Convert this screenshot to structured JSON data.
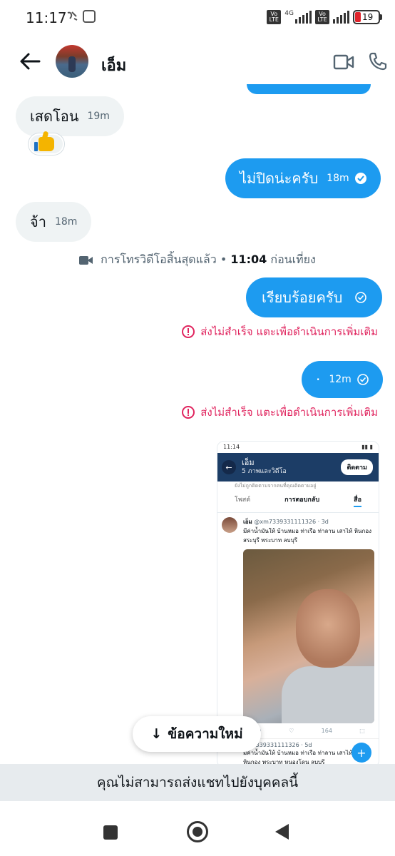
{
  "status_bar": {
    "time": "11:17",
    "net_type": "4G",
    "volte_label": "Vo LTE",
    "battery": "19"
  },
  "header": {
    "contact_name": "เอ็ม"
  },
  "messages": [
    {
      "direction": "in",
      "text": "เสดโอน",
      "time": "19m",
      "reaction": "thumbs-up"
    },
    {
      "direction": "out",
      "text": "ไม่ปิดน่ะครับ",
      "time": "18m",
      "status": "read"
    },
    {
      "direction": "in",
      "text": "จ้า",
      "time": "18m"
    },
    {
      "direction": "out",
      "text": "เรียบร้อยครับ",
      "time": "",
      "status": "failed"
    },
    {
      "direction": "out",
      "text": "·",
      "time": "12m",
      "status": "failed"
    }
  ],
  "call_notice": {
    "text": "การโทรวิดีโอสิ้นสุดแล้ว",
    "separator": "•",
    "time": "11:04",
    "suffix": "ก่อนเที่ยง"
  },
  "error_text": "ส่งไม่สำเร็จ แตะเพื่อดำเนินการเพิ่มเติม",
  "image_message": {
    "status_time": "11:14",
    "profile_name": "เอ็ม",
    "profile_sub": "5 ภาพและวิดีโอ",
    "follow_label": "ติดตาม",
    "note": "ยังไม่ถูกติดตามจากคนที่คุณติดตามอยู่",
    "tabs": [
      "โพสต์",
      "การตอบกลับ",
      "สื่อ"
    ],
    "post1_name": "เอ็ม",
    "post1_handle": "@xm7339331111326 · 3d",
    "post1_text": "มีค่าน้ำมันให้ บ้านหมอ ท่าเรือ ท่าลาน เสาไห้ หินกอง สระบุรี พระบาท ลบบุรี",
    "views": "164",
    "post2_handle": "xm7339331111326 · 5d",
    "post2_text": "มีค่าน้ำมันให้ บ้านหมอ ท่าเรือ ท่าลาน เสาไห้ สระบุรี หินกอง พระบาท หนองโดน ลบบุรี"
  },
  "new_messages_pill": {
    "arrow": "↓",
    "label": "ข้อความใหม่"
  },
  "cant_send_text": "คุณไม่สามารถส่งแชทไปยังบุคคลนี้",
  "colors": {
    "accent": "#1d9bf0",
    "incoming_bubble": "#eff3f4",
    "error": "#e0245e",
    "banner_bg": "#e7ebee"
  },
  "icons": {
    "back": "arrow-left-icon",
    "video": "video-camera-icon",
    "call": "phone-icon",
    "error": "error-circle-icon"
  }
}
